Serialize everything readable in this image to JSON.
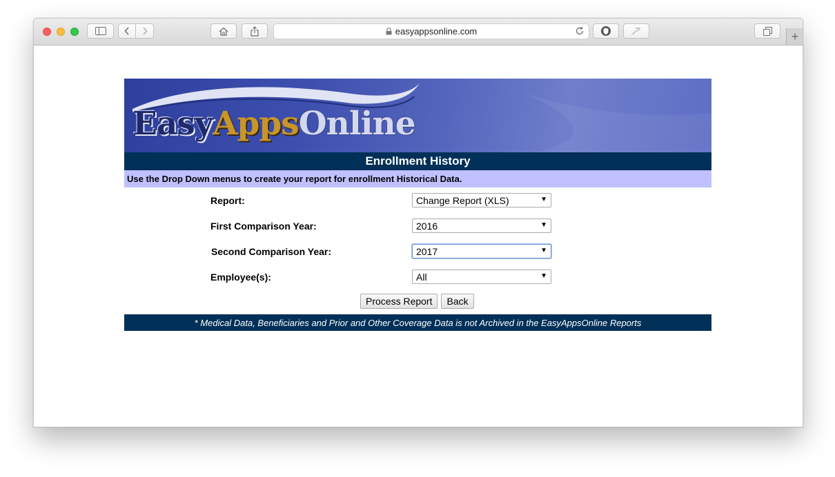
{
  "browser": {
    "url": "easyappsonline.com"
  },
  "page": {
    "logo": {
      "easy": "Easy",
      "apps": "Apps",
      "online": "Online"
    },
    "title": "Enrollment History",
    "instructions": "Use the Drop Down menus to create your report for enrollment Historical Data.",
    "form": {
      "report": {
        "label": "Report:",
        "value": "Change Report (XLS)"
      },
      "first_year": {
        "label": "First Comparison Year:",
        "value": "2016"
      },
      "second_year": {
        "label": "Second Comparison Year:",
        "value": "2017"
      },
      "employees": {
        "label": "Employee(s):",
        "value": "All"
      }
    },
    "buttons": {
      "process": "Process Report",
      "back": "Back"
    },
    "footer_note": "* Medical Data, Beneficiaries and Prior and Other Coverage Data is not Archived in the EasyAppsOnline Reports"
  },
  "colors": {
    "header_bar": "#003058",
    "instruction_bar": "#c0c0ff",
    "banner_blue": "#3d4fae",
    "logo_gold": "#c8952a"
  }
}
